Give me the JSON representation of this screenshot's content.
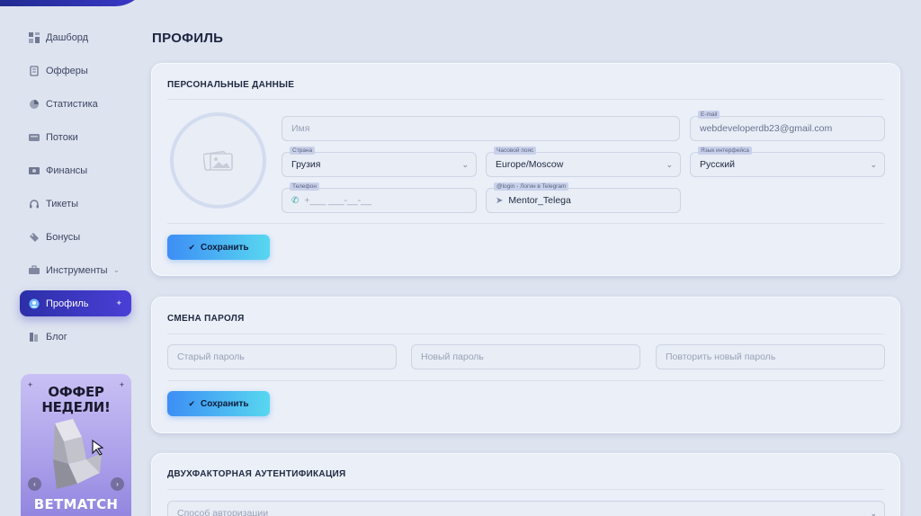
{
  "nav": {
    "items": [
      {
        "label": "Дашборд",
        "icon": "dashboard-icon"
      },
      {
        "label": "Офферы",
        "icon": "offers-icon"
      },
      {
        "label": "Статистика",
        "icon": "stats-icon"
      },
      {
        "label": "Потоки",
        "icon": "streams-icon"
      },
      {
        "label": "Финансы",
        "icon": "finance-icon"
      },
      {
        "label": "Тикеты",
        "icon": "headset-icon"
      },
      {
        "label": "Бонусы",
        "icon": "bonus-icon"
      },
      {
        "label": "Инструменты",
        "icon": "tools-icon"
      },
      {
        "label": "Профиль",
        "icon": "profile-icon"
      },
      {
        "label": "Блог",
        "icon": "blog-icon"
      }
    ],
    "active": "Профиль"
  },
  "promo": {
    "title_line1": "ОФФЕР",
    "title_line2": "НЕДЕЛИ!",
    "brand": "BETMATCH"
  },
  "page": {
    "title": "ПРОФИЛЬ"
  },
  "personal": {
    "title": "ПЕРСОНАЛЬНЫЕ ДАННЫЕ",
    "name_placeholder": "Имя",
    "email_label": "E-mail",
    "email_value": "webdeveloperdb23@gmail.com",
    "country_label": "Страна",
    "country_value": "Грузия",
    "timezone_label": "Часовой пояс",
    "timezone_value": "Europe/Moscow",
    "language_label": "Язык интерфейса",
    "language_value": "Русский",
    "phone_label": "Телефон",
    "phone_placeholder": "+___ ___-__-__",
    "telegram_label": "@login - Логин в Telegram",
    "telegram_value": "Mentor_Telega",
    "save_label": "Сохранить"
  },
  "password": {
    "title": "СМЕНА ПАРОЛЯ",
    "old_placeholder": "Старый пароль",
    "new_placeholder": "Новый пароль",
    "repeat_placeholder": "Повторить новый пароль",
    "save_label": "Сохранить"
  },
  "twofa": {
    "title": "ДВУХФАКТОРНАЯ АУТЕНТИФИКАЦИЯ",
    "method_placeholder": "Способ авторизации"
  },
  "colors": {
    "accent": "#3b38c9",
    "button_start": "#3d8ef5",
    "button_end": "#58d7f0",
    "background": "#dde3ef"
  }
}
